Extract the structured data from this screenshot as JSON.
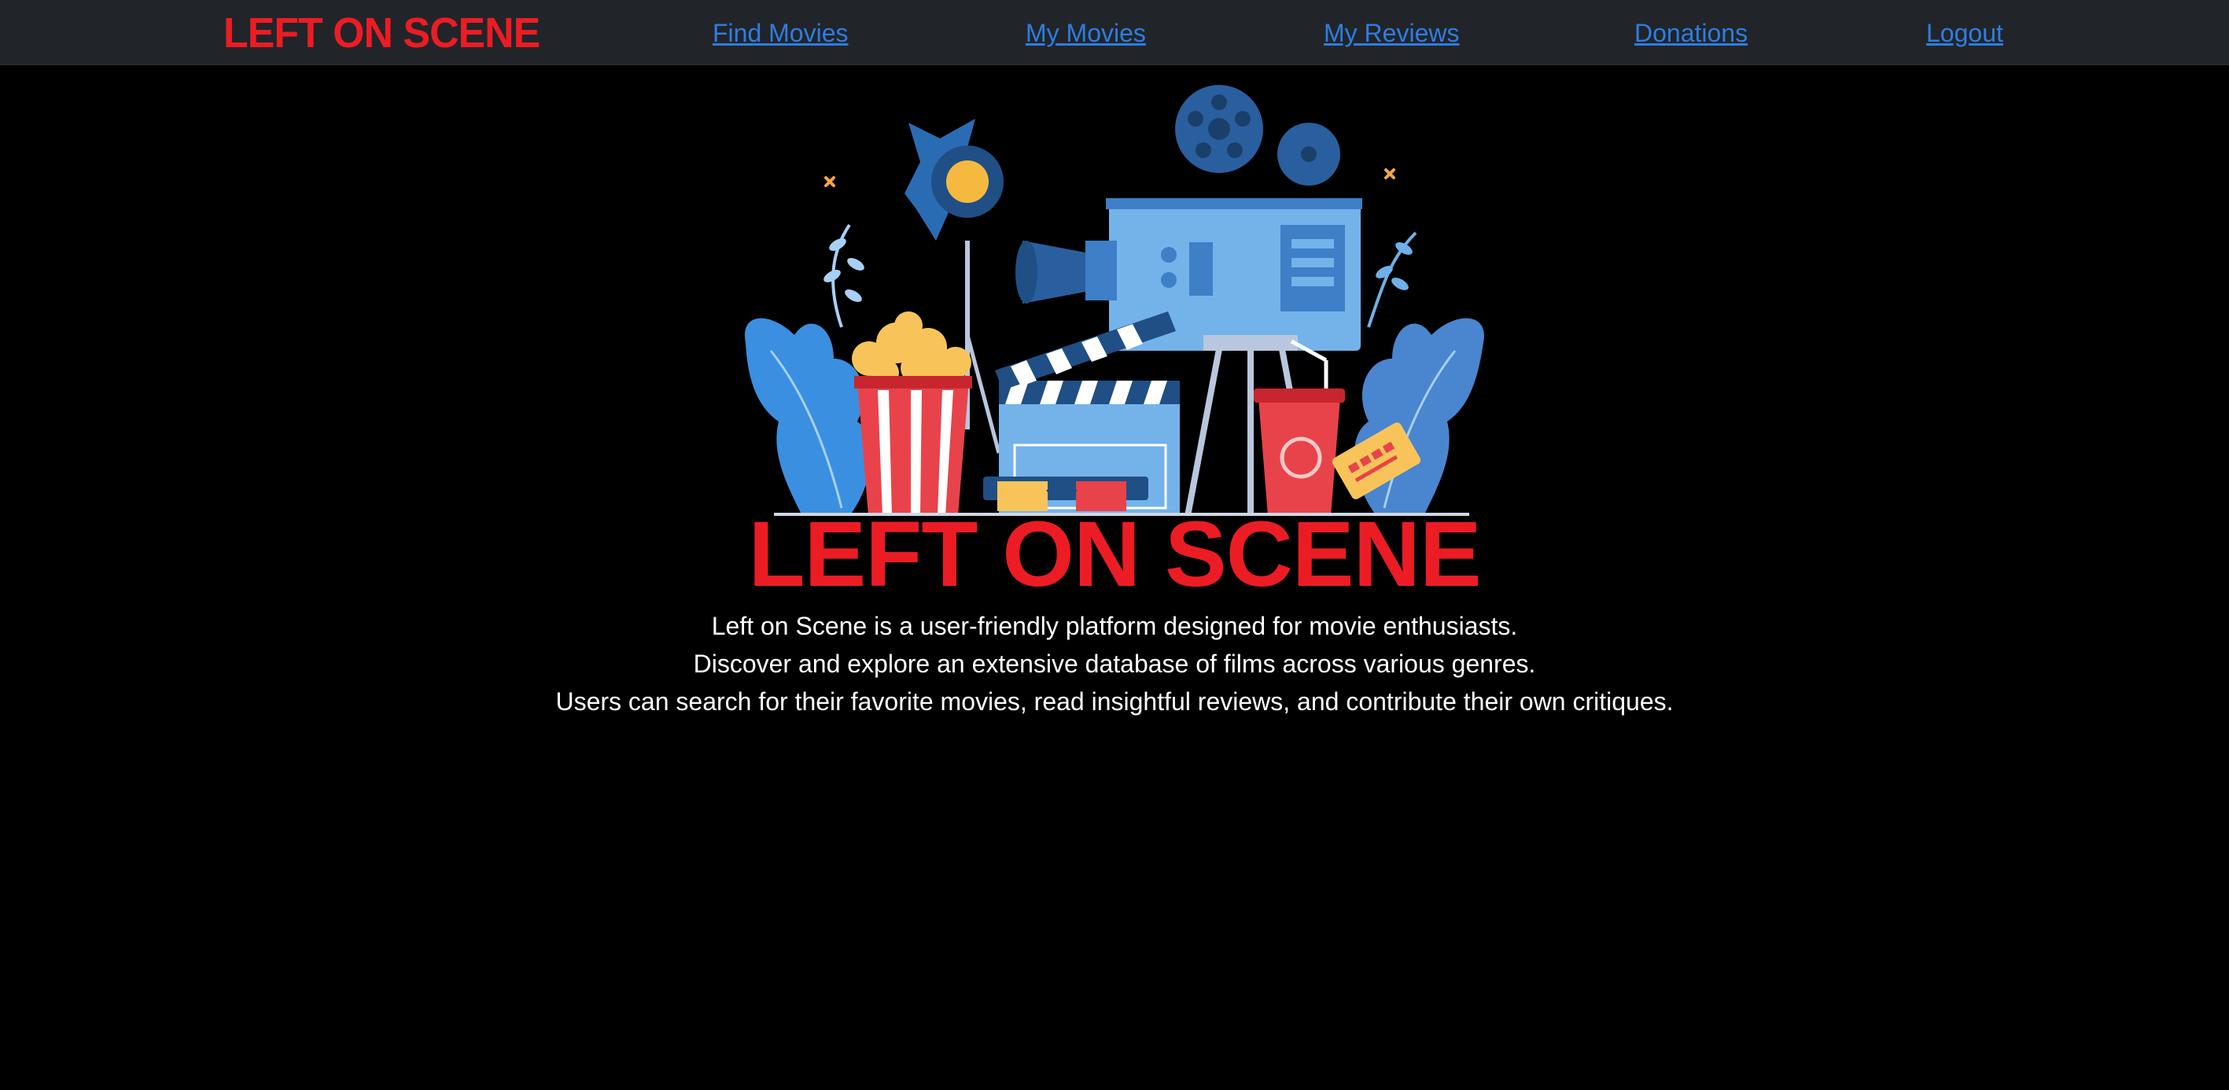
{
  "nav": {
    "brand": "LEFT ON SCENE",
    "links": [
      {
        "label": "Find Movies"
      },
      {
        "label": "My Movies"
      },
      {
        "label": "My Reviews"
      },
      {
        "label": "Donations"
      },
      {
        "label": "Logout"
      }
    ]
  },
  "hero": {
    "logo_title": "LEFT ON SCENE",
    "illustration": "cinema-illustration",
    "description": [
      "Left on Scene is a user-friendly platform designed for movie enthusiasts.",
      "Discover and explore an extensive database of films across various genres.",
      "Users can search for their favorite movies, read insightful reviews, and contribute their own critiques."
    ]
  },
  "colors": {
    "brand_red": "#ec1c24",
    "navbar_bg": "#212529",
    "link_blue": "#2f7de1",
    "page_bg": "#000000",
    "text": "#ffffff"
  }
}
